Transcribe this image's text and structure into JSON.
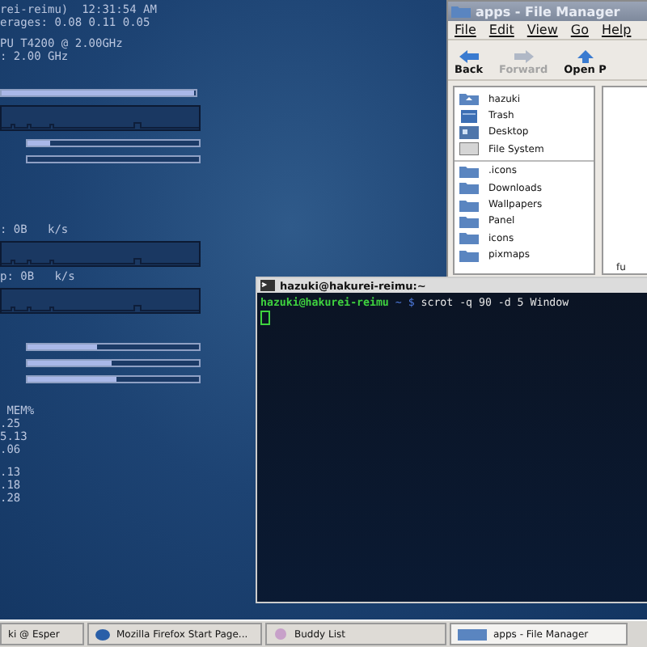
{
  "conky": {
    "sections": [
      {
        "items": [
          {
            "kind": "text",
            "text": "rei-reimu)  12:31:54 AM"
          },
          {
            "kind": "text",
            "text": "erages: 0.08 0.11 0.05"
          }
        ]
      },
      {
        "items": [
          {
            "kind": "text",
            "text": "PU T4200 @ 2.00GHz"
          },
          {
            "kind": "text",
            "text": ": 2.00 GHz"
          }
        ]
      },
      {
        "items": [
          {
            "kind": "bar",
            "level": 0.99
          },
          {
            "kind": "graph"
          },
          {
            "kind": "shortbar",
            "level": 0.13
          },
          {
            "kind": "shortbar",
            "level": 0
          }
        ]
      },
      {
        "items": [
          {
            "kind": "text",
            "text": ": 0B   k/s"
          },
          {
            "kind": "graph"
          },
          {
            "kind": "text",
            "text": "p: 0B   k/s"
          },
          {
            "kind": "graph"
          }
        ]
      },
      {
        "items": [
          {
            "kind": "shortbar",
            "level": 0.41
          },
          {
            "kind": "shortbar",
            "level": 0.49
          },
          {
            "kind": "shortbar",
            "level": 0.52
          }
        ]
      },
      {
        "items": [
          {
            "kind": "text",
            "text": " MEM%"
          },
          {
            "kind": "text",
            "text": ".25"
          },
          {
            "kind": "text",
            "text": "5.13"
          },
          {
            "kind": "text",
            "text": ".06"
          }
        ]
      },
      {
        "items": [
          {
            "kind": "text",
            "text": ".13"
          },
          {
            "kind": "text",
            "text": ".18"
          },
          {
            "kind": "text",
            "text": ".28"
          }
        ]
      }
    ]
  },
  "file_manager": {
    "title": "apps - File Manager",
    "menu": [
      "File",
      "Edit",
      "View",
      "Go",
      "Help"
    ],
    "toolbar": [
      {
        "label": "Back",
        "disabled": false
      },
      {
        "label": "Forward",
        "disabled": true
      },
      {
        "label": "Open P",
        "disabled": false
      }
    ],
    "places": [
      {
        "label": "hazuki",
        "kind": "home"
      },
      {
        "label": "Trash",
        "kind": "trash"
      },
      {
        "label": "Desktop",
        "kind": "desktop"
      },
      {
        "label": "File System",
        "kind": "drive"
      }
    ],
    "folders": [
      ".icons",
      "Downloads",
      "Wallpapers",
      "Panel",
      "icons",
      "pixmaps"
    ],
    "pane_text": "fu"
  },
  "terminal": {
    "title": "hazuki@hakurei-reimu:~",
    "user_host": "hazuki@hakurei-reimu",
    "path": " ~ $ ",
    "command": "scrot -q 90 -d 5 Window"
  },
  "taskbar": [
    {
      "label": "ki @ Esper",
      "selected": false
    },
    {
      "label": "Mozilla Firefox Start Page...",
      "selected": false
    },
    {
      "label": "Buddy List",
      "selected": false
    },
    {
      "label": "apps - File Manager",
      "selected": true
    }
  ]
}
